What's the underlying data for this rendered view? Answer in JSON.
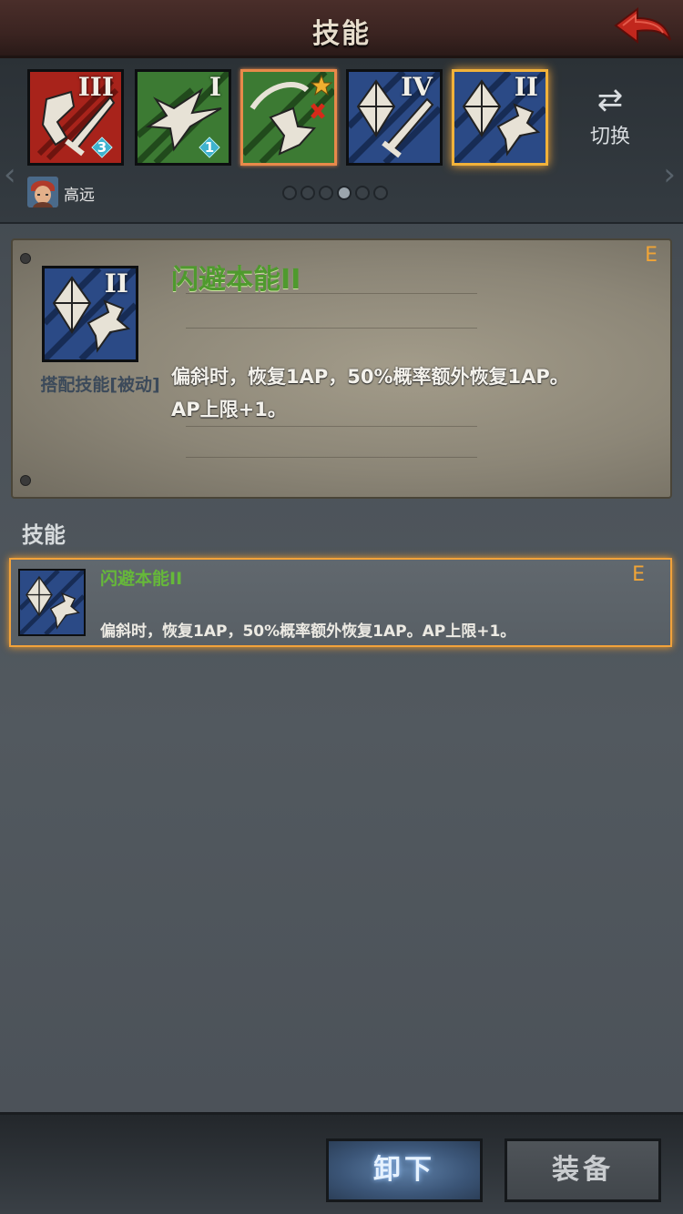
{
  "header": {
    "title": "技能"
  },
  "skills": [
    {
      "rank": "III",
      "theme": "red",
      "badge": "3",
      "selected": "none"
    },
    {
      "rank": "I",
      "theme": "green",
      "badge": "1",
      "selected": "none"
    },
    {
      "rank": "",
      "theme": "green",
      "badge": "",
      "selected": "orange"
    },
    {
      "rank": "IV",
      "theme": "blue",
      "badge": "",
      "selected": "none"
    },
    {
      "rank": "II",
      "theme": "blue",
      "badge": "",
      "selected": "gold"
    }
  ],
  "switch": {
    "label": "切换"
  },
  "hero": {
    "name": "高远"
  },
  "pager": {
    "total": 6,
    "active": 3
  },
  "detail": {
    "name": "闪避本能II",
    "rank": "II",
    "grade": "E",
    "type": "搭配技能[被动]",
    "desc_line1": "偏斜时，恢复1AP，50%概率额外恢复1AP。",
    "desc_line2": "AP上限+1。"
  },
  "section": {
    "title": "技能"
  },
  "list": [
    {
      "name": "闪避本能II",
      "grade": "E",
      "desc": "偏斜时，恢复1AP，50%概率额外恢复1AP。AP上限+1。"
    }
  ],
  "footer": {
    "unequip_label": "卸下",
    "equip_label": "装备"
  },
  "colors": {
    "red": "#a8231b",
    "green": "#3c7a33",
    "blue": "#2b4a86",
    "accent": "#f2a23a",
    "skill_name": "#4f9a2e"
  }
}
